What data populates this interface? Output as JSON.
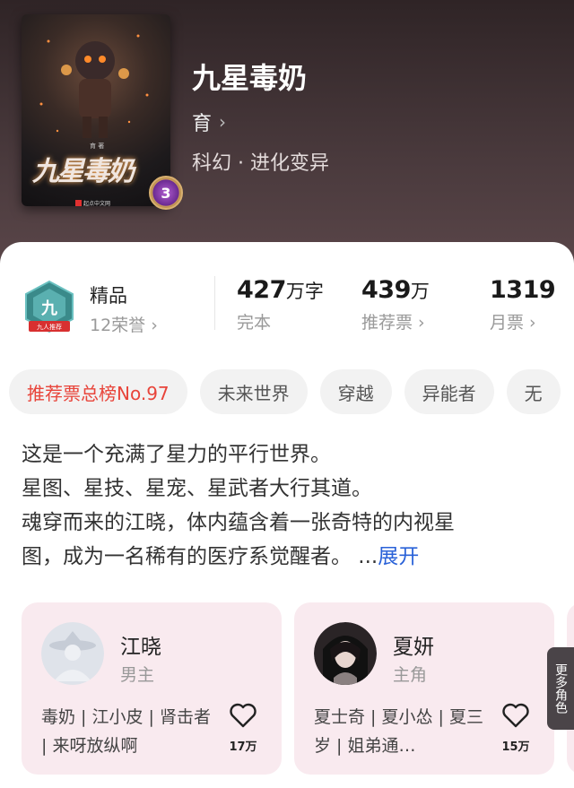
{
  "book": {
    "title": "九星毒奶",
    "author": "育",
    "genre": "科幻 · 进化变异",
    "cover_title": "九星毒奶",
    "cover_author": "育 著",
    "cover_publisher": "起点中文网",
    "cover_badge": "3"
  },
  "stats": {
    "honor_name": "精品",
    "honor_sub": "12荣誉",
    "honor_badge_text": "九人推荐",
    "words_num": "427",
    "words_unit": "万字",
    "words_label": "完本",
    "rec_num": "439",
    "rec_unit": "万",
    "rec_label": "推荐票",
    "monthly_num": "1319",
    "monthly_label": "月票"
  },
  "tags": [
    "推荐票总榜No.97",
    "未来世界",
    "穿越",
    "异能者",
    "无"
  ],
  "description": {
    "lines": [
      "这是一个充满了星力的平行世界。",
      "星图、星技、星宠、星武者大行其道。",
      "魂穿而来的江晓，体内蕴含着一张奇特的内视星",
      "图，成为一名稀有的医疗系觉醒者。 ..."
    ],
    "expand_label": "展开"
  },
  "characters": [
    {
      "name": "江晓",
      "role": "男主",
      "tags": "毒奶 | 江小皮 | 肾击者 | 来呀放纵啊",
      "likes": "17万",
      "avatar": "default-avatar"
    },
    {
      "name": "夏妍",
      "role": "主角",
      "tags": "夏士奇 | 夏小怂 | 夏三岁 | 姐弟通…",
      "likes": "15万",
      "avatar": "character-portrait"
    }
  ],
  "more_characters_label": "更多角色",
  "colors": {
    "accent_red": "#e8443a",
    "link_blue": "#2a62d8",
    "char_card_bg": "#f9eaef",
    "header_bg": "#4a3a3c"
  }
}
